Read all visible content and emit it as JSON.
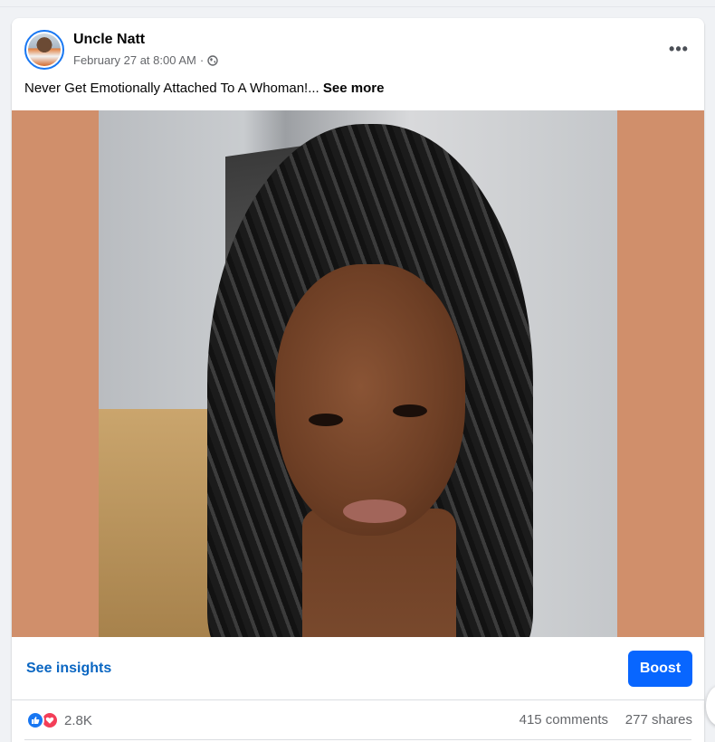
{
  "post": {
    "author": "Uncle Natt",
    "timestamp": "February 27 at 8:00 AM",
    "separator": "·",
    "privacy_icon": "globe-icon",
    "more_label": "•••",
    "text": "Never Get Emotionally Attached To A Whoman!... ",
    "see_more": "See more"
  },
  "actions": {
    "insights_label": "See insights",
    "boost_label": "Boost"
  },
  "stats": {
    "reaction_icons": [
      "like-icon",
      "love-icon"
    ],
    "reaction_count": "2.8K",
    "comments": "415 comments",
    "shares": "277 shares"
  },
  "colors": {
    "accent": "#0866ff",
    "link": "#0a66c2",
    "media_background": "#d08f6b",
    "like": "#1877f2",
    "love": "#f33e58"
  }
}
